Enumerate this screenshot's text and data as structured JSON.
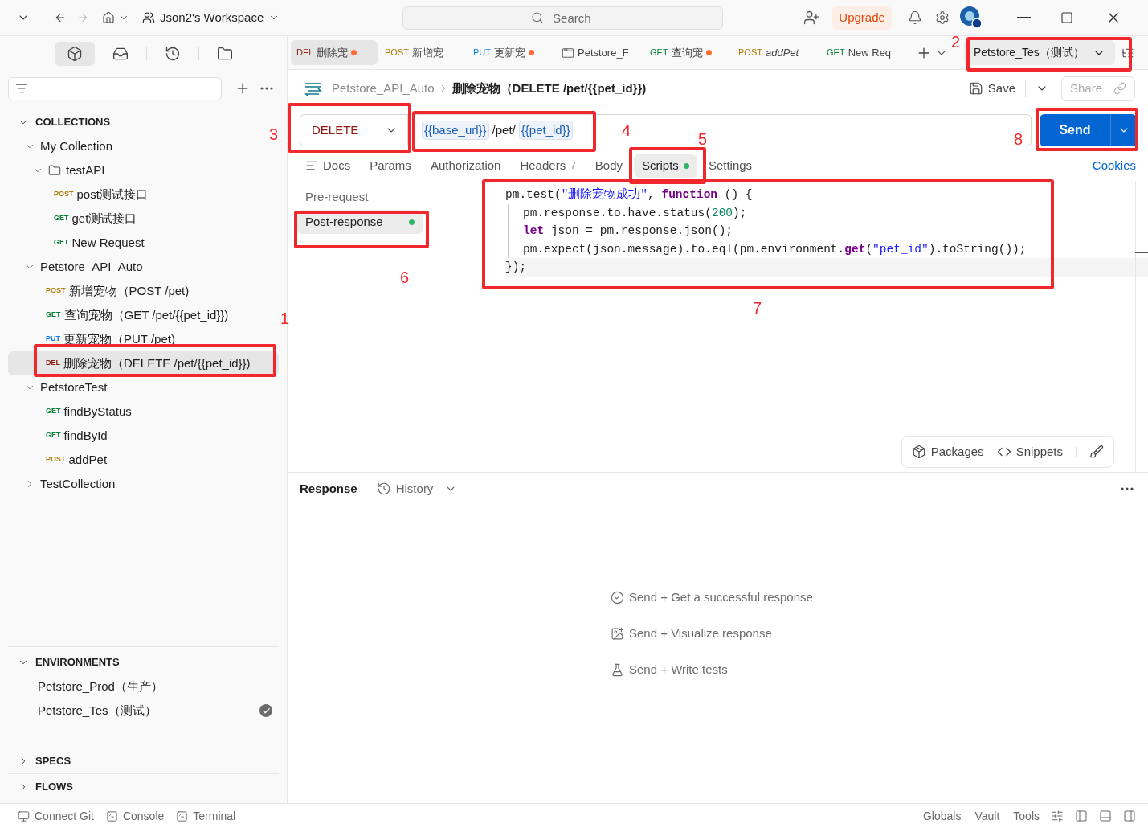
{
  "topbar": {
    "workspace": "Json2's Workspace",
    "search": {
      "placeholder": "Search"
    },
    "upgrade": "Upgrade"
  },
  "sidebar": {
    "collections": {
      "title": "COLLECTIONS",
      "expanded": true,
      "items": [
        {
          "kind": "collection",
          "label": "My Collection",
          "expanded": true,
          "children": [
            {
              "kind": "folder",
              "label": "testAPI",
              "expanded": true,
              "children": [
                {
                  "kind": "request",
                  "method": "POST",
                  "label": "post测试接口",
                  "selected": false
                },
                {
                  "kind": "request",
                  "method": "GET",
                  "label": "get测试接口",
                  "selected": false
                },
                {
                  "kind": "request",
                  "method": "GET",
                  "label": "New Request",
                  "selected": false
                }
              ]
            }
          ]
        },
        {
          "kind": "collection",
          "label": "Petstore_API_Auto",
          "expanded": true,
          "children": [
            {
              "kind": "request",
              "method": "POST",
              "label": "新增宠物（POST /pet)",
              "selected": false
            },
            {
              "kind": "request",
              "method": "GET",
              "label": "查询宠物（GET /pet/{{pet_id}})",
              "selected": false
            },
            {
              "kind": "request",
              "method": "PUT",
              "label": "更新宠物（PUT /pet)",
              "selected": false
            },
            {
              "kind": "request",
              "method": "DEL",
              "label": "删除宠物（DELETE /pet/{{pet_id}})",
              "selected": true
            }
          ]
        },
        {
          "kind": "collection",
          "label": "PetstoreTest",
          "expanded": true,
          "children": [
            {
              "kind": "request",
              "method": "GET",
              "label": "findByStatus",
              "selected": false
            },
            {
              "kind": "request",
              "method": "GET",
              "label": "findById",
              "selected": false
            },
            {
              "kind": "request",
              "method": "POST",
              "label": "addPet",
              "selected": false
            }
          ]
        },
        {
          "kind": "collection",
          "label": "TestCollection",
          "expanded": false
        }
      ]
    },
    "environments": {
      "title": "ENVIRONMENTS",
      "expanded": true,
      "items": [
        {
          "label": "Petstore_Prod（生产）",
          "active": false
        },
        {
          "label": "Petstore_Tes（测试）",
          "active": true
        }
      ]
    },
    "sections": [
      {
        "title": "SPECS",
        "expanded": false
      },
      {
        "title": "FLOWS",
        "expanded": false
      }
    ]
  },
  "open_tabs": [
    {
      "kind": "request",
      "method": "DEL",
      "label": "删除宠",
      "modified": true,
      "selected": true
    },
    {
      "kind": "request",
      "method": "POST",
      "label": "新增宠",
      "modified": false,
      "selected": false
    },
    {
      "kind": "request",
      "method": "PUT",
      "label": "更新宠",
      "modified": true,
      "selected": false
    },
    {
      "kind": "environment",
      "label": "Petstore_F",
      "modified": false,
      "selected": false
    },
    {
      "kind": "request",
      "method": "GET",
      "label": "查询宠",
      "modified": true,
      "selected": false
    },
    {
      "kind": "preview",
      "method": "POST",
      "label": "addPet",
      "modified": false,
      "selected": false
    },
    {
      "kind": "request",
      "method": "GET",
      "label": "New Req",
      "modified": false,
      "selected": false
    }
  ],
  "environment_selector": "Petstore_Tes（测试）",
  "breadcrumb": {
    "collection": "Petstore_API_Auto",
    "title": "删除宠物（DELETE /pet/{{pet_id}})"
  },
  "actions": {
    "save": "Save",
    "share": "Share"
  },
  "request": {
    "method": "DELETE",
    "url": [
      {
        "kind": "variable",
        "text": "{{base_url}}"
      },
      {
        "kind": "plain",
        "text": "/pet/"
      },
      {
        "kind": "variable",
        "text": "{{pet_id}}"
      }
    ],
    "send": "Send"
  },
  "request_tabs": [
    {
      "label": "Docs",
      "selected": false
    },
    {
      "label": "Params",
      "selected": false
    },
    {
      "label": "Authorization",
      "selected": false
    },
    {
      "label": "Headers",
      "count": "7",
      "selected": false
    },
    {
      "label": "Body",
      "selected": false
    },
    {
      "label": "Scripts",
      "dot": true,
      "selected": true
    },
    {
      "label": "Settings",
      "selected": false
    }
  ],
  "cookies": "Cookies",
  "script_tabs": [
    {
      "label": "Pre-request",
      "dot": false,
      "selected": false
    },
    {
      "label": "Post-response",
      "dot": true,
      "selected": true
    }
  ],
  "code": [
    {
      "indent": false,
      "tokens": [
        {
          "kind": "plain",
          "text": "pm.test("
        },
        {
          "kind": "string",
          "text": "\"删除宠物成功\""
        },
        {
          "kind": "plain",
          "text": ", "
        },
        {
          "kind": "keyword",
          "text": "function"
        },
        {
          "kind": "plain",
          "text": " () {"
        }
      ]
    },
    {
      "indent": true,
      "tokens": [
        {
          "kind": "plain",
          "text": "pm.response.to.have.status("
        },
        {
          "kind": "number",
          "text": "200"
        },
        {
          "kind": "plain",
          "text": ");"
        }
      ]
    },
    {
      "indent": true,
      "tokens": [
        {
          "kind": "keyword",
          "text": "let"
        },
        {
          "kind": "plain",
          "text": " json = pm.response.json();"
        }
      ]
    },
    {
      "indent": true,
      "tokens": [
        {
          "kind": "plain",
          "text": "pm.expect(json.message).to.eql(pm.environment."
        },
        {
          "kind": "keyword",
          "text": "get"
        },
        {
          "kind": "plain",
          "text": "("
        },
        {
          "kind": "string",
          "text": "\"pet_id\""
        },
        {
          "kind": "plain",
          "text": ").toString());"
        }
      ]
    },
    {
      "indent": false,
      "tokens": [
        {
          "kind": "plain",
          "text": "});"
        }
      ]
    }
  ],
  "script_tools": {
    "packages": "Packages",
    "snippets": "Snippets"
  },
  "response": {
    "title": "Response",
    "history": "History",
    "hints": [
      {
        "kind": "success",
        "text": "Send + Get a successful response"
      },
      {
        "kind": "visualize",
        "text": "Send + Visualize response"
      },
      {
        "kind": "tests",
        "text": "Send + Write tests"
      }
    ]
  },
  "status_bar": {
    "left": [
      {
        "kind": "git",
        "label": "Connect Git"
      },
      {
        "kind": "console",
        "label": "Console"
      },
      {
        "kind": "terminal",
        "label": "Terminal"
      }
    ],
    "right": [
      "Globals",
      "Vault",
      "Tools"
    ]
  },
  "annotations": [
    "1",
    "2",
    "3",
    "4",
    "5",
    "6",
    "7",
    "8"
  ]
}
